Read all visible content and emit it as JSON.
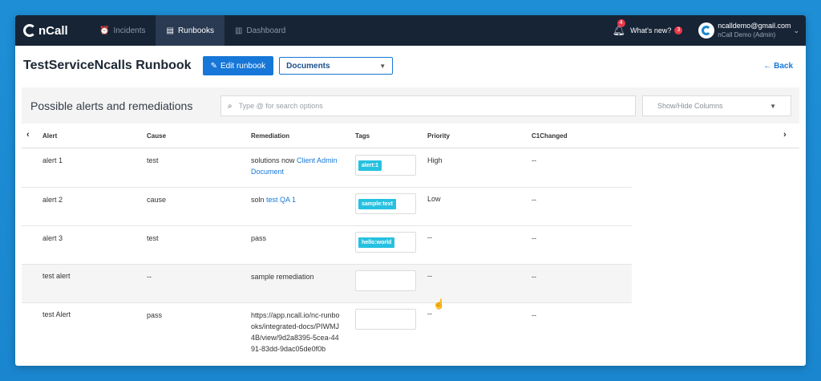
{
  "nav": {
    "brand": "nCall",
    "items": [
      {
        "label": "Incidents",
        "icon": "alarm-clock-icon"
      },
      {
        "label": "Runbooks",
        "icon": "book-icon"
      },
      {
        "label": "Dashboard",
        "icon": "bar-chart-icon"
      }
    ],
    "notifications_count": "4",
    "whats_new": "What's new?",
    "whats_new_count": "3",
    "user_email": "ncalldemo@gmail.com",
    "user_role": "nCall Demo (Admin)"
  },
  "header": {
    "title": "TestServiceNcalls Runbook",
    "edit_label": "Edit runbook",
    "select_value": "Documents",
    "back_label": "Back"
  },
  "panel": {
    "title": "Possible alerts and remediations",
    "search_placeholder": "Type @ for search options",
    "columns_label": "Show/Hide Columns"
  },
  "table": {
    "headers": [
      "Alert",
      "Cause",
      "Remediation",
      "Tags",
      "Priority",
      "C1Changed"
    ],
    "rows": [
      {
        "alert": "alert 1",
        "cause": "test",
        "rem_text": "solutions now ",
        "rem_link": "Client Admin Document",
        "tag": "alert:1",
        "priority": "High",
        "c1": "--"
      },
      {
        "alert": "alert 2",
        "cause": "cause",
        "rem_text": "soln ",
        "rem_link": "test QA 1",
        "tag": "sample:text",
        "priority": "Low",
        "c1": "--"
      },
      {
        "alert": "alert 3",
        "cause": "test",
        "rem_text": "pass",
        "rem_link": "",
        "tag": "hello:world",
        "priority": "--",
        "c1": "--"
      },
      {
        "alert": "test alert",
        "cause": "--",
        "rem_text": "sample remediation",
        "rem_link": "",
        "tag": "",
        "priority": "--",
        "c1": "--"
      },
      {
        "alert": "test Alert",
        "cause": "pass",
        "rem_text": "https://app.ncall.io/nc-runbooks/integrated-docs/PIWMJ4B/view/9d2a8395-5cea-4491-83dd-9dac05de0f0b",
        "rem_link": "",
        "tag": "",
        "priority": "--",
        "c1": "--"
      }
    ]
  },
  "colors": {
    "nav_bg": "#172436",
    "accent": "#1677d8",
    "tag": "#26c1e0"
  }
}
